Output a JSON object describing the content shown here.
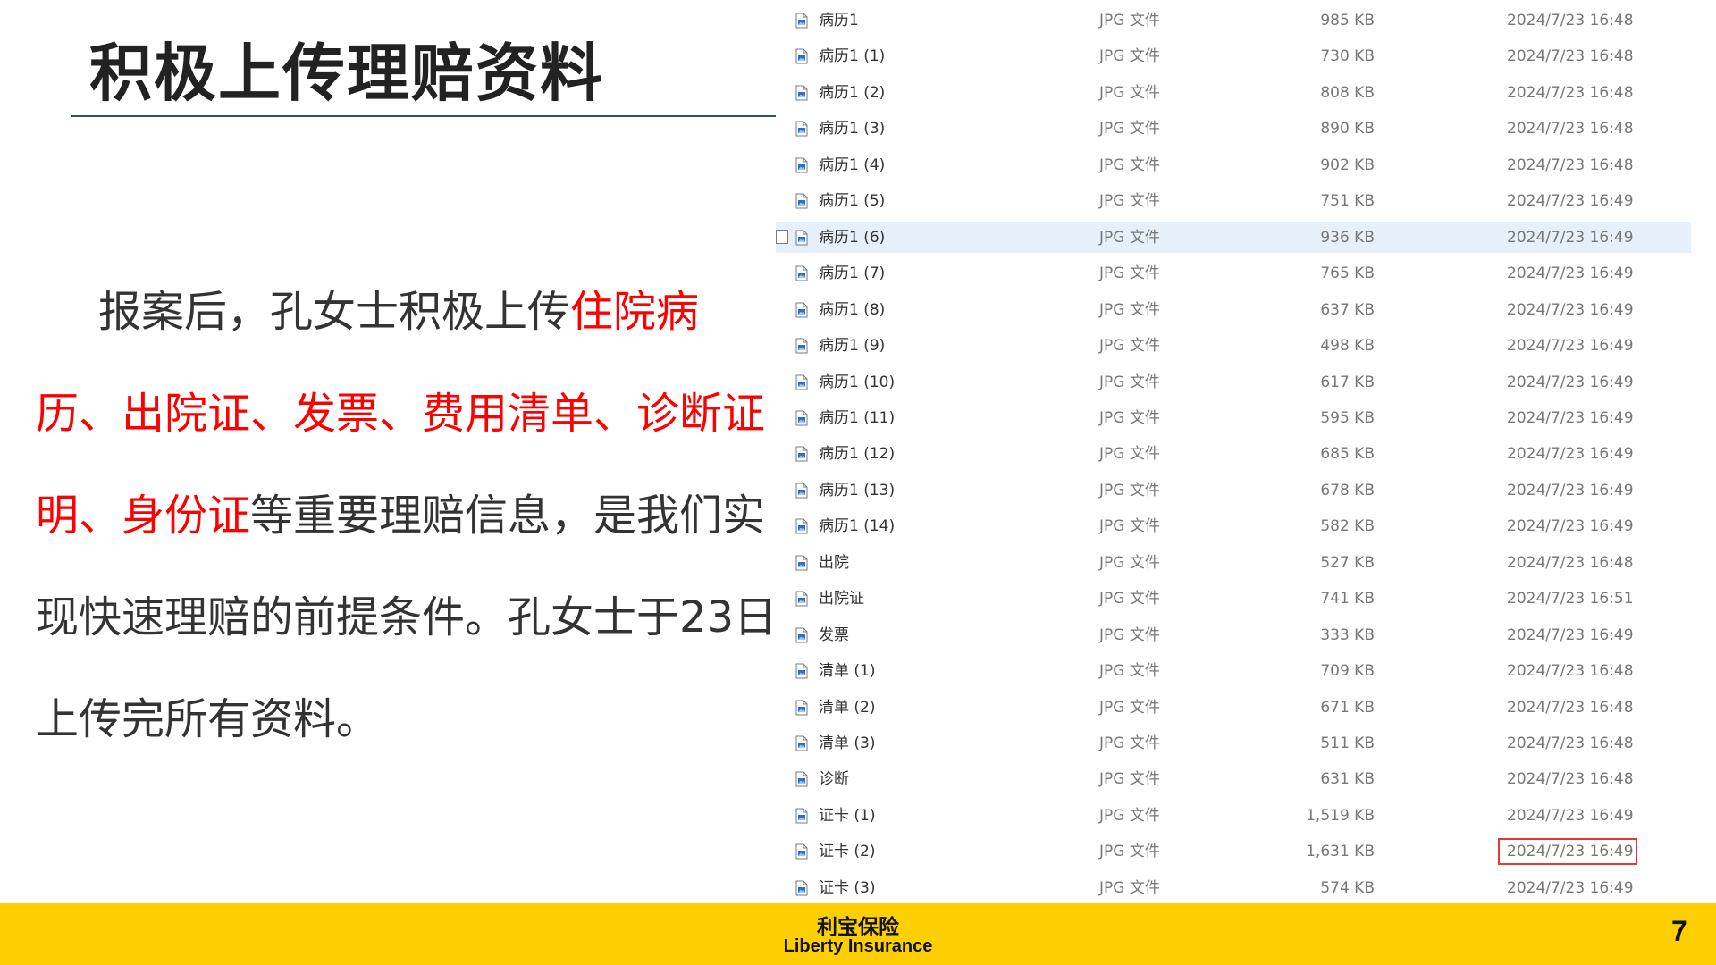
{
  "slide": {
    "title": "积极上传理赔资料",
    "body": [
      {
        "text": "报案后，孔女士积极上传",
        "highlight": false
      },
      {
        "text": "住院病历、出院证、发票、费用清单、诊断证明、身份证",
        "highlight": true
      },
      {
        "text": "等重要理赔信息，是我们实现快速理赔的前提条件。孔女士于23日上传完所有资料。",
        "highlight": false
      }
    ],
    "highlight_color": "#ff0000",
    "page_number": "7"
  },
  "footer": {
    "brand_cn": "利宝保险",
    "brand_en": "Liberty Insurance",
    "color": "#fdcf00"
  },
  "file_list": {
    "rows": [
      {
        "name": "病历1",
        "type": "JPG 文件",
        "size": "985 KB",
        "date": "2024/7/23 16:48"
      },
      {
        "name": "病历1 (1)",
        "type": "JPG 文件",
        "size": "730 KB",
        "date": "2024/7/23 16:48"
      },
      {
        "name": "病历1 (2)",
        "type": "JPG 文件",
        "size": "808 KB",
        "date": "2024/7/23 16:48"
      },
      {
        "name": "病历1 (3)",
        "type": "JPG 文件",
        "size": "890 KB",
        "date": "2024/7/23 16:48"
      },
      {
        "name": "病历1 (4)",
        "type": "JPG 文件",
        "size": "902 KB",
        "date": "2024/7/23 16:48"
      },
      {
        "name": "病历1 (5)",
        "type": "JPG 文件",
        "size": "751 KB",
        "date": "2024/7/23 16:49"
      },
      {
        "name": "病历1 (6)",
        "type": "JPG 文件",
        "size": "936 KB",
        "date": "2024/7/23 16:49",
        "selected": true
      },
      {
        "name": "病历1 (7)",
        "type": "JPG 文件",
        "size": "765 KB",
        "date": "2024/7/23 16:49"
      },
      {
        "name": "病历1 (8)",
        "type": "JPG 文件",
        "size": "637 KB",
        "date": "2024/7/23 16:49"
      },
      {
        "name": "病历1 (9)",
        "type": "JPG 文件",
        "size": "498 KB",
        "date": "2024/7/23 16:49"
      },
      {
        "name": "病历1 (10)",
        "type": "JPG 文件",
        "size": "617 KB",
        "date": "2024/7/23 16:49"
      },
      {
        "name": "病历1 (11)",
        "type": "JPG 文件",
        "size": "595 KB",
        "date": "2024/7/23 16:49"
      },
      {
        "name": "病历1 (12)",
        "type": "JPG 文件",
        "size": "685 KB",
        "date": "2024/7/23 16:49"
      },
      {
        "name": "病历1 (13)",
        "type": "JPG 文件",
        "size": "678 KB",
        "date": "2024/7/23 16:49"
      },
      {
        "name": "病历1 (14)",
        "type": "JPG 文件",
        "size": "582 KB",
        "date": "2024/7/23 16:49"
      },
      {
        "name": "出院",
        "type": "JPG 文件",
        "size": "527 KB",
        "date": "2024/7/23 16:48"
      },
      {
        "name": "出院证",
        "type": "JPG 文件",
        "size": "741 KB",
        "date": "2024/7/23 16:51"
      },
      {
        "name": "发票",
        "type": "JPG 文件",
        "size": "333 KB",
        "date": "2024/7/23 16:49"
      },
      {
        "name": "清单 (1)",
        "type": "JPG 文件",
        "size": "709 KB",
        "date": "2024/7/23 16:48"
      },
      {
        "name": "清单 (2)",
        "type": "JPG 文件",
        "size": "671 KB",
        "date": "2024/7/23 16:48"
      },
      {
        "name": "清单 (3)",
        "type": "JPG 文件",
        "size": "511 KB",
        "date": "2024/7/23 16:48"
      },
      {
        "name": "诊断",
        "type": "JPG 文件",
        "size": "631 KB",
        "date": "2024/7/23 16:48"
      },
      {
        "name": "证卡 (1)",
        "type": "JPG 文件",
        "size": "1,519 KB",
        "date": "2024/7/23 16:49"
      },
      {
        "name": "证卡 (2)",
        "type": "JPG 文件",
        "size": "1,631 KB",
        "date": "2024/7/23 16:49",
        "date_highlighted": true
      },
      {
        "name": "证卡 (3)",
        "type": "JPG 文件",
        "size": "574 KB",
        "date": "2024/7/23 16:49"
      }
    ],
    "file_icon": "jpg-file-icon",
    "highlight_box_color": "#e53935",
    "selected_row_color": "#e5f0fb"
  }
}
